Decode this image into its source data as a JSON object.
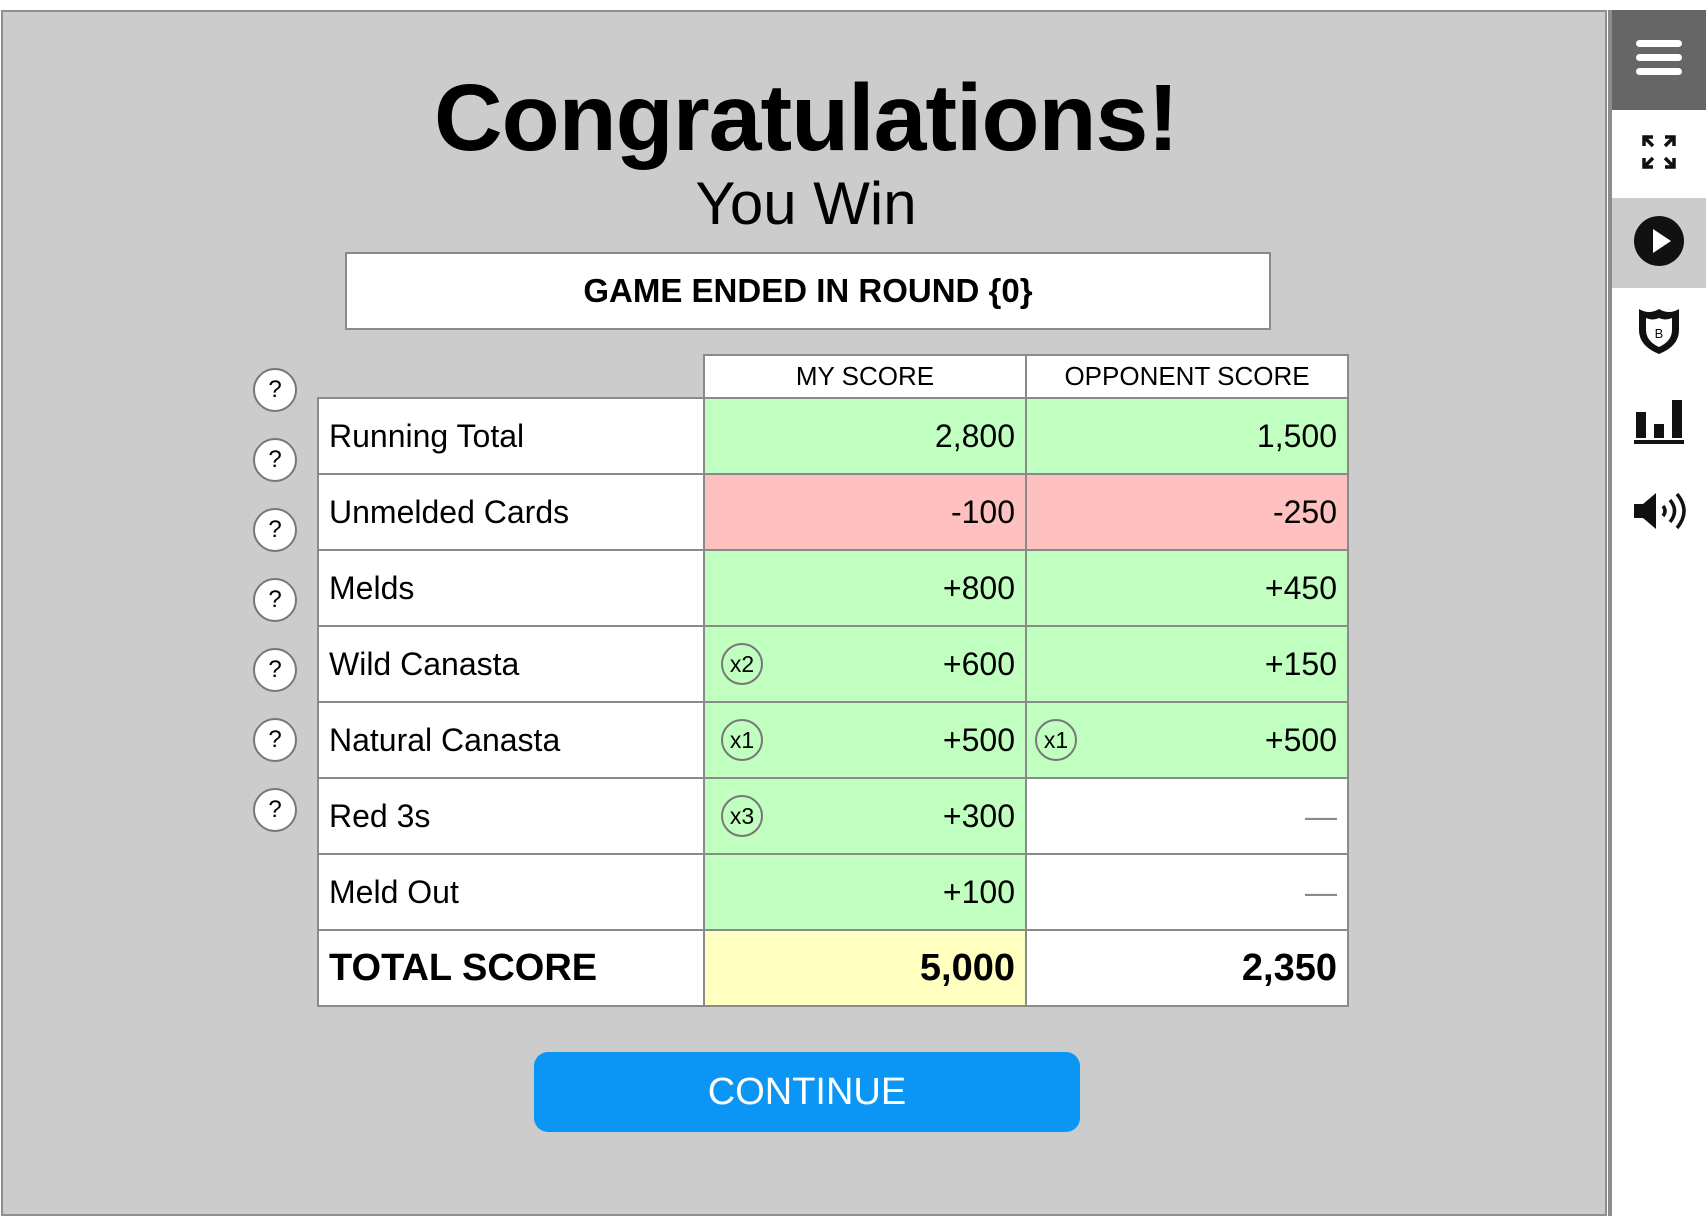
{
  "header": {
    "title": "Congratulations!",
    "subtitle": "You Win",
    "round_text": "GAME ENDED IN ROUND {0}"
  },
  "table": {
    "columns": [
      "MY SCORE",
      "OPPONENT SCORE"
    ],
    "rows": [
      {
        "label": "Running Total",
        "my": "2,800",
        "my_mult": "",
        "opp": "1,500",
        "opp_mult": "",
        "my_color": "green",
        "opp_color": "green",
        "help": "?"
      },
      {
        "label": "Unmelded Cards",
        "my": "-100",
        "my_mult": "",
        "opp": "-250",
        "opp_mult": "",
        "my_color": "red",
        "opp_color": "red",
        "help": "?"
      },
      {
        "label": "Melds",
        "my": "+800",
        "my_mult": "",
        "opp": "+450",
        "opp_mult": "",
        "my_color": "green",
        "opp_color": "green",
        "help": "?"
      },
      {
        "label": "Wild Canasta",
        "my": "+600",
        "my_mult": "x2",
        "opp": "+150",
        "opp_mult": "",
        "my_color": "green",
        "opp_color": "green",
        "help": "?"
      },
      {
        "label": "Natural Canasta",
        "my": "+500",
        "my_mult": "x1",
        "opp": "+500",
        "opp_mult": "x1",
        "my_color": "green",
        "opp_color": "green",
        "help": "?"
      },
      {
        "label": "Red 3s",
        "my": "+300",
        "my_mult": "x3",
        "opp": "—",
        "opp_mult": "",
        "my_color": "green",
        "opp_color": "white",
        "help": "?"
      },
      {
        "label": "Meld Out",
        "my": "+100",
        "my_mult": "",
        "opp": "—",
        "opp_mult": "",
        "my_color": "green",
        "opp_color": "white",
        "help": "?"
      }
    ],
    "total": {
      "label": "TOTAL SCORE",
      "my": "5,000",
      "opp": "2,350"
    }
  },
  "continue_label": "CONTINUE",
  "toolbar": {
    "icons": [
      "menu-icon",
      "fullscreen-icon",
      "play-icon",
      "badge-shield-icon",
      "stats-icon",
      "volume-icon"
    ],
    "badge_letter": "B"
  },
  "colors": {
    "green": "#c0ffc0",
    "red": "#ffc0c0",
    "yellow": "#ffffc0",
    "button": "#0b96f6",
    "background": "#cccccc"
  }
}
